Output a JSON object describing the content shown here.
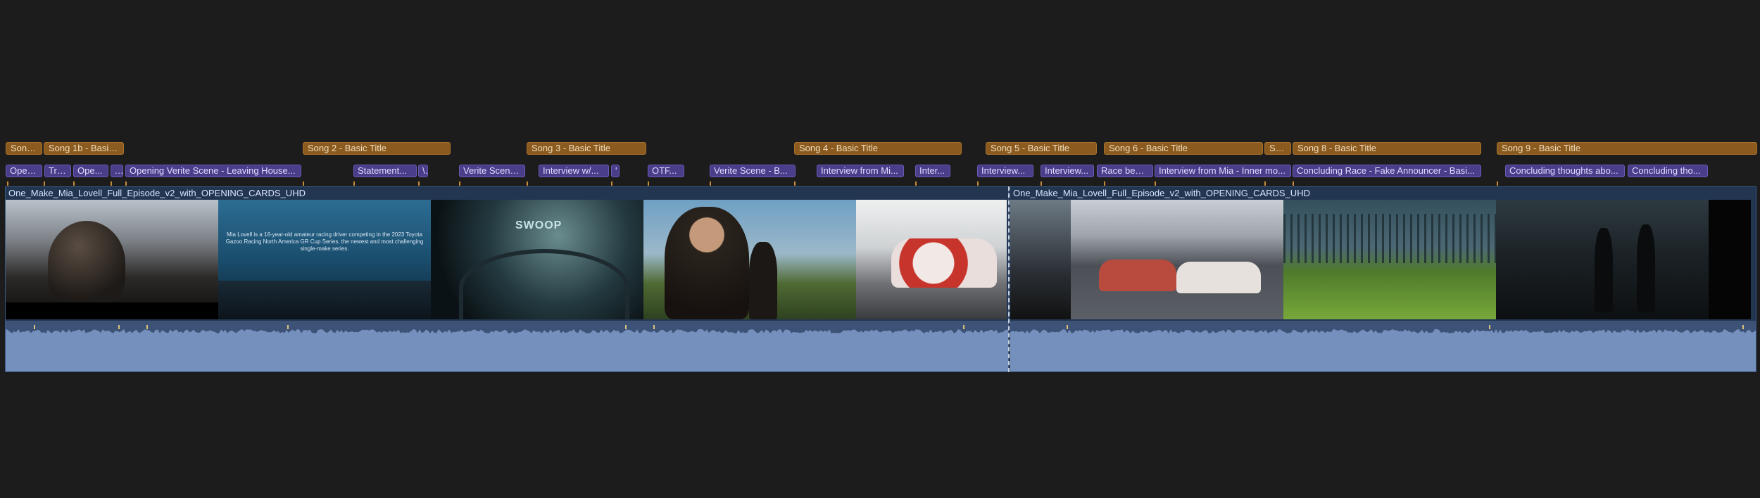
{
  "title_clips": [
    {
      "label": "Song..."
    },
    {
      "label": "Song 1b - Basic..."
    },
    {
      "label": "Song 2 - Basic Title"
    },
    {
      "label": "Song 3 - Basic Title"
    },
    {
      "label": "Song 4 - Basic Title"
    },
    {
      "label": "Song 5 - Basic Title"
    },
    {
      "label": "Song 6 - Basic Title"
    },
    {
      "label": "So..."
    },
    {
      "label": "Song 8 - Basic Title"
    },
    {
      "label": "Song 9 - Basic Title"
    }
  ],
  "text_clips": [
    {
      "label": "Openi..."
    },
    {
      "label": "Tra..."
    },
    {
      "label": "Ope..."
    },
    {
      "label": "..."
    },
    {
      "label": "Opening Verite Scene - Leaving House..."
    },
    {
      "label": "Statement..."
    },
    {
      "label": "\\"
    },
    {
      "label": "Verite Scene..."
    },
    {
      "label": "Interview w/..."
    },
    {
      "label": "'"
    },
    {
      "label": "OTF..."
    },
    {
      "label": "Verite Scene - B..."
    },
    {
      "label": "Interview from Mi..."
    },
    {
      "label": "Inter..."
    },
    {
      "label": "Interview..."
    },
    {
      "label": "Interview..."
    },
    {
      "label": "Race begi..."
    },
    {
      "label": "Interview from Mia - Inner mo..."
    },
    {
      "label": "Concluding Race - Fake Announcer - Basi..."
    },
    {
      "label": "Concluding thoughts abo..."
    },
    {
      "label": "Concluding tho..."
    }
  ],
  "video_clips": [
    {
      "name": "One_Make_Mia_Lovell_Full_Episode_v2_with_OPENING_CARDS_UHD"
    },
    {
      "name": "One_Make_Mia_Lovell_Full_Episode_v2_with_OPENING_CARDS_UHD"
    }
  ],
  "frame_card_text": "Mia Lovell is a 16-year-old amateur racing driver competing in the 2023 Toyota Gazoo Racing North America GR Cup Series, the newest and most challenging single-make series.",
  "frame_badge_text": "SWOOP",
  "colors": {
    "background": "#1c1c1d",
    "title_clip": "#8a5a1e",
    "text_clip": "#4a3d8a",
    "video_clip": "#233651",
    "audio_wave": "#7590bd"
  }
}
